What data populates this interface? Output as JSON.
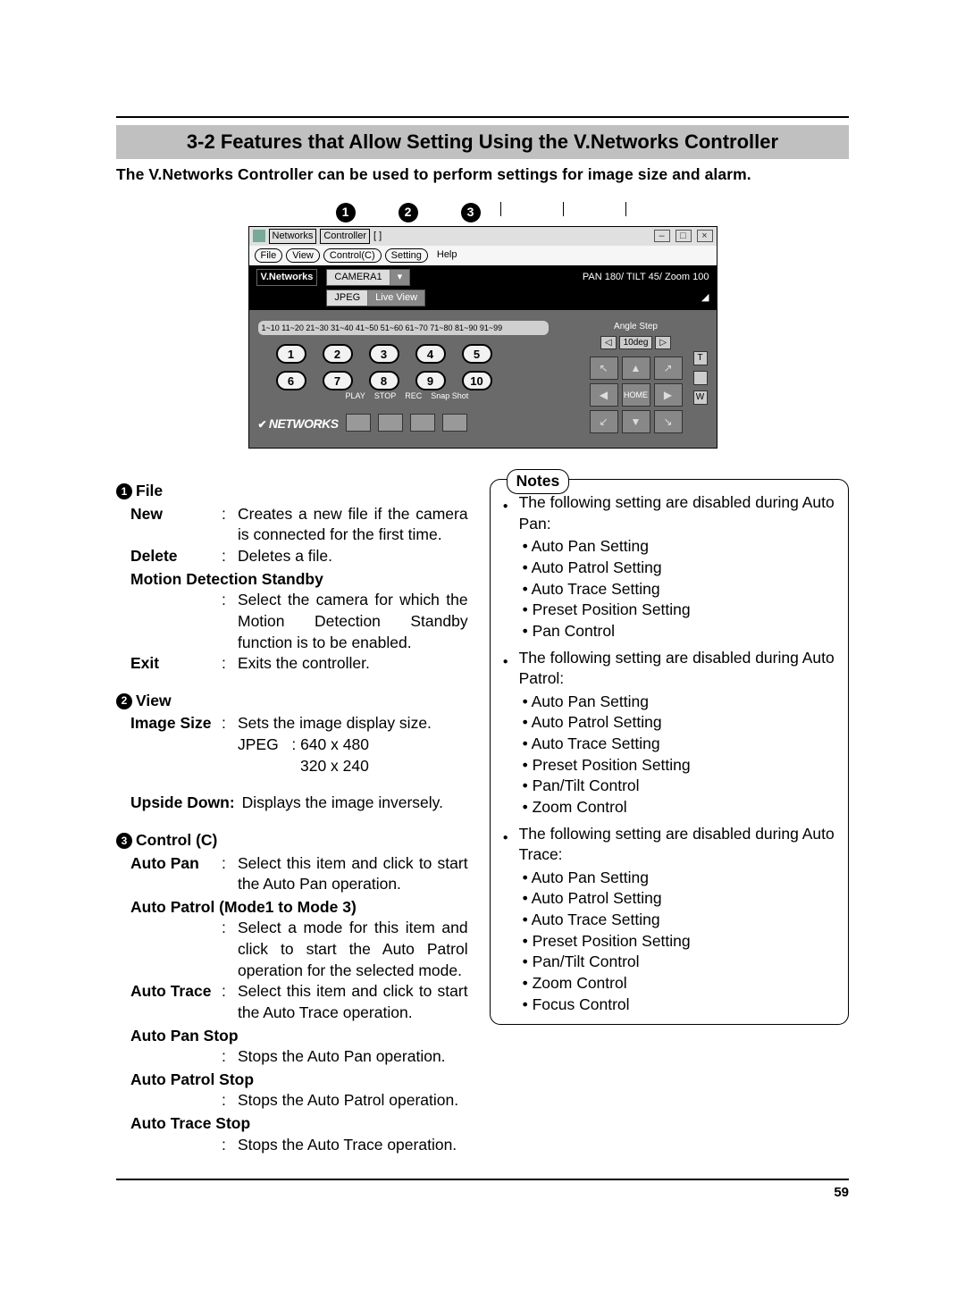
{
  "section": {
    "title": "3-2 Features that Allow Setting Using the V.Networks Controller",
    "lead": "The V.Networks Controller can be used to perform settings for image size and alarm."
  },
  "callouts": [
    "1",
    "2",
    "3"
  ],
  "shot": {
    "titlebar": {
      "app": "Networks",
      "controller": "Controller",
      "brackets": "[ ]"
    },
    "menus": {
      "file": "File",
      "view": "View",
      "control": "Control(C)",
      "setting": "Setting",
      "help": "Help"
    },
    "vbar": {
      "brand": "V.Networks",
      "camera": "CAMERA1",
      "fmt": "JPEG",
      "mode": "Live View",
      "ptz": "PAN 180/ TILT 45/ Zoom 100"
    },
    "tabs": "1~10  11~20  21~30  31~40  41~50  51~60  61~70  71~80  81~90  91~99",
    "angle_label": "Angle Step",
    "angle_val": "10deg",
    "home": "HOME",
    "botlabels": {
      "play": "PLAY",
      "stop": "STOP",
      "rec": "REC",
      "snap": "Snap Shot"
    },
    "botbrand": "NETWORKS",
    "t": "T",
    "w": "W"
  },
  "file": {
    "head": "File",
    "new": {
      "term": "New",
      "body": "Creates a new file if the camera is connected for the first time."
    },
    "delete": {
      "term": "Delete",
      "body": "Deletes a file."
    },
    "mds": {
      "term": "Motion Detection Standby",
      "body": "Select the camera for which the Motion Detection Standby function is to be enabled."
    },
    "exit": {
      "term": "Exit",
      "body": "Exits the controller."
    }
  },
  "view": {
    "head": "View",
    "imgsize": {
      "term": "Image Size",
      "body": "Sets the image display size.",
      "jlab": "JPEG",
      "jcolon": ":",
      "j1": "640 x 480",
      "j2": "320 x 240"
    },
    "upside": {
      "term": "Upside Down",
      "colon": ":",
      "body": "Displays the image inversely."
    }
  },
  "control": {
    "head": "Control (C)",
    "autopan": {
      "term": "Auto Pan",
      "body": "Select this item and click to start the Auto Pan operation."
    },
    "autopatrol": {
      "term": "Auto Patrol (Mode1 to Mode 3)",
      "body": "Select a mode for this item and click to start the Auto Patrol operation for the selected mode."
    },
    "autotrace": {
      "term": "Auto Trace",
      "body": "Select this item and click to start the Auto Trace operation."
    },
    "autopanstop": {
      "term": "Auto Pan Stop",
      "body": "Stops the Auto Pan operation."
    },
    "autopatrolstop": {
      "term": "Auto Patrol Stop",
      "body": "Stops the Auto Patrol operation."
    },
    "autotracestop": {
      "term": "Auto Trace Stop",
      "body": "Stops the Auto Trace operation."
    }
  },
  "notes": {
    "title": "Notes",
    "g1": {
      "lead": "The following setting are disabled during Auto Pan:",
      "items": [
        "Auto Pan Setting",
        "Auto Patrol Setting",
        "Auto Trace Setting",
        "Preset Position Setting",
        "Pan Control"
      ]
    },
    "g2": {
      "lead": "The following setting are disabled during Auto Patrol:",
      "items": [
        "Auto Pan Setting",
        "Auto Patrol Setting",
        "Auto Trace Setting",
        "Preset Position Setting",
        "Pan/Tilt Control",
        "Zoom Control"
      ]
    },
    "g3": {
      "lead": "The following setting are disabled during Auto Trace:",
      "items": [
        "Auto Pan Setting",
        "Auto Patrol Setting",
        "Auto Trace Setting",
        "Preset Position Setting",
        "Pan/Tilt Control",
        "Zoom Control",
        "Focus Control"
      ]
    }
  },
  "pagenum": "59"
}
